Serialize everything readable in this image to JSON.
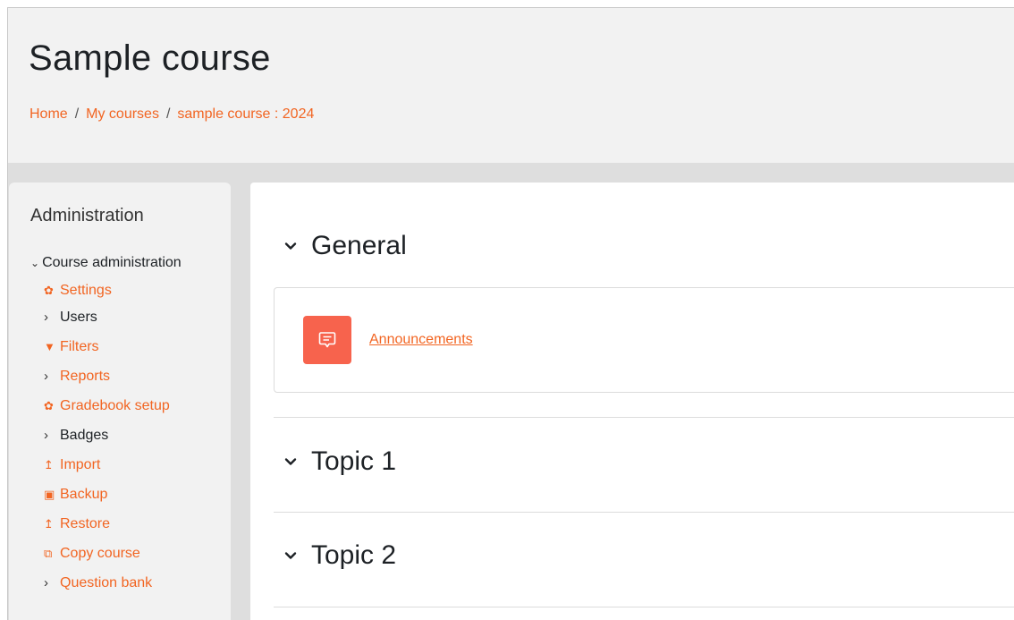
{
  "header": {
    "title": "Sample course",
    "breadcrumb": [
      {
        "label": "Home"
      },
      {
        "label": "My courses"
      },
      {
        "label": "sample course : 2024"
      }
    ],
    "separator": "/"
  },
  "admin": {
    "title": "Administration",
    "root_label": "Course administration",
    "root_icon": "chevron-down-icon",
    "items": [
      {
        "label": "Settings",
        "icon": "gear-icon",
        "glyph": "✿",
        "style": "link"
      },
      {
        "label": "Users",
        "icon": "chevron-right-icon",
        "glyph": "›",
        "style": "plain"
      },
      {
        "label": "Filters",
        "icon": "filter-icon",
        "glyph": "▼",
        "style": "link"
      },
      {
        "label": "Reports",
        "icon": "chevron-right-icon",
        "glyph": "›",
        "style": "link"
      },
      {
        "label": "Gradebook setup",
        "icon": "gear-icon",
        "glyph": "✿",
        "style": "link"
      },
      {
        "label": "Badges",
        "icon": "chevron-right-icon",
        "glyph": "›",
        "style": "plain"
      },
      {
        "label": "Import",
        "icon": "upload-icon",
        "glyph": "↥",
        "style": "link"
      },
      {
        "label": "Backup",
        "icon": "file-archive-icon",
        "glyph": "▣",
        "style": "link"
      },
      {
        "label": "Restore",
        "icon": "upload-icon",
        "glyph": "↥",
        "style": "link"
      },
      {
        "label": "Copy course",
        "icon": "copy-icon",
        "glyph": "⧉",
        "style": "link"
      },
      {
        "label": "Question bank",
        "icon": "chevron-right-icon",
        "glyph": "›",
        "style": "link"
      }
    ]
  },
  "main": {
    "sections": [
      {
        "title": "General",
        "expanded": true
      },
      {
        "title": "Topic 1",
        "expanded": true
      },
      {
        "title": "Topic 2",
        "expanded": true
      }
    ],
    "activity": {
      "name": "Announcements",
      "icon": "forum-icon"
    }
  },
  "colors": {
    "accent": "#f26522",
    "forum_icon_bg": "#f7634d",
    "header_bg": "#f2f2f2",
    "page_bg": "#dedede"
  }
}
